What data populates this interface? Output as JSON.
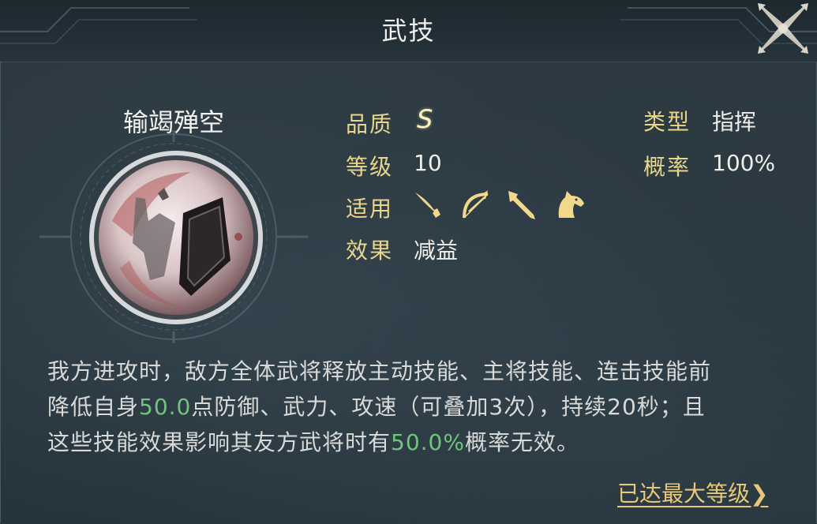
{
  "window": {
    "title": "武技"
  },
  "skill": {
    "name": "输竭殚空",
    "icon": "skill-shield-warrior-icon"
  },
  "attributes": {
    "quality_label": "品质",
    "quality_value": "S",
    "level_label": "等级",
    "level_value": "10",
    "applicable_label": "适用",
    "applicable_icons": [
      "saber-icon",
      "bow-icon",
      "spear-icon",
      "horse-icon"
    ],
    "effect_label": "效果",
    "effect_value": "减益",
    "type_label": "类型",
    "type_value": "指挥",
    "chance_label": "概率",
    "chance_value": "100%"
  },
  "description": {
    "line1": "我方进攻时，敌方全体武将释放主动技能、主将技能、连击技能前",
    "line2_prefix": "降低自身",
    "line2_value": "50.0",
    "line2_suffix": "点防御、武力、攻速（可叠加3次），持续20秒；且",
    "line3_prefix": "这些技能效果影响其友方武将时有",
    "line3_value": "50.0%",
    "line3_suffix": "概率无效。"
  },
  "footer": {
    "max_level_label": "已达最大等级",
    "arrow": "❯"
  },
  "colors": {
    "label_gold": "#e8d68c",
    "highlight_green": "#6fc57a",
    "link_gold": "#e6c878"
  }
}
